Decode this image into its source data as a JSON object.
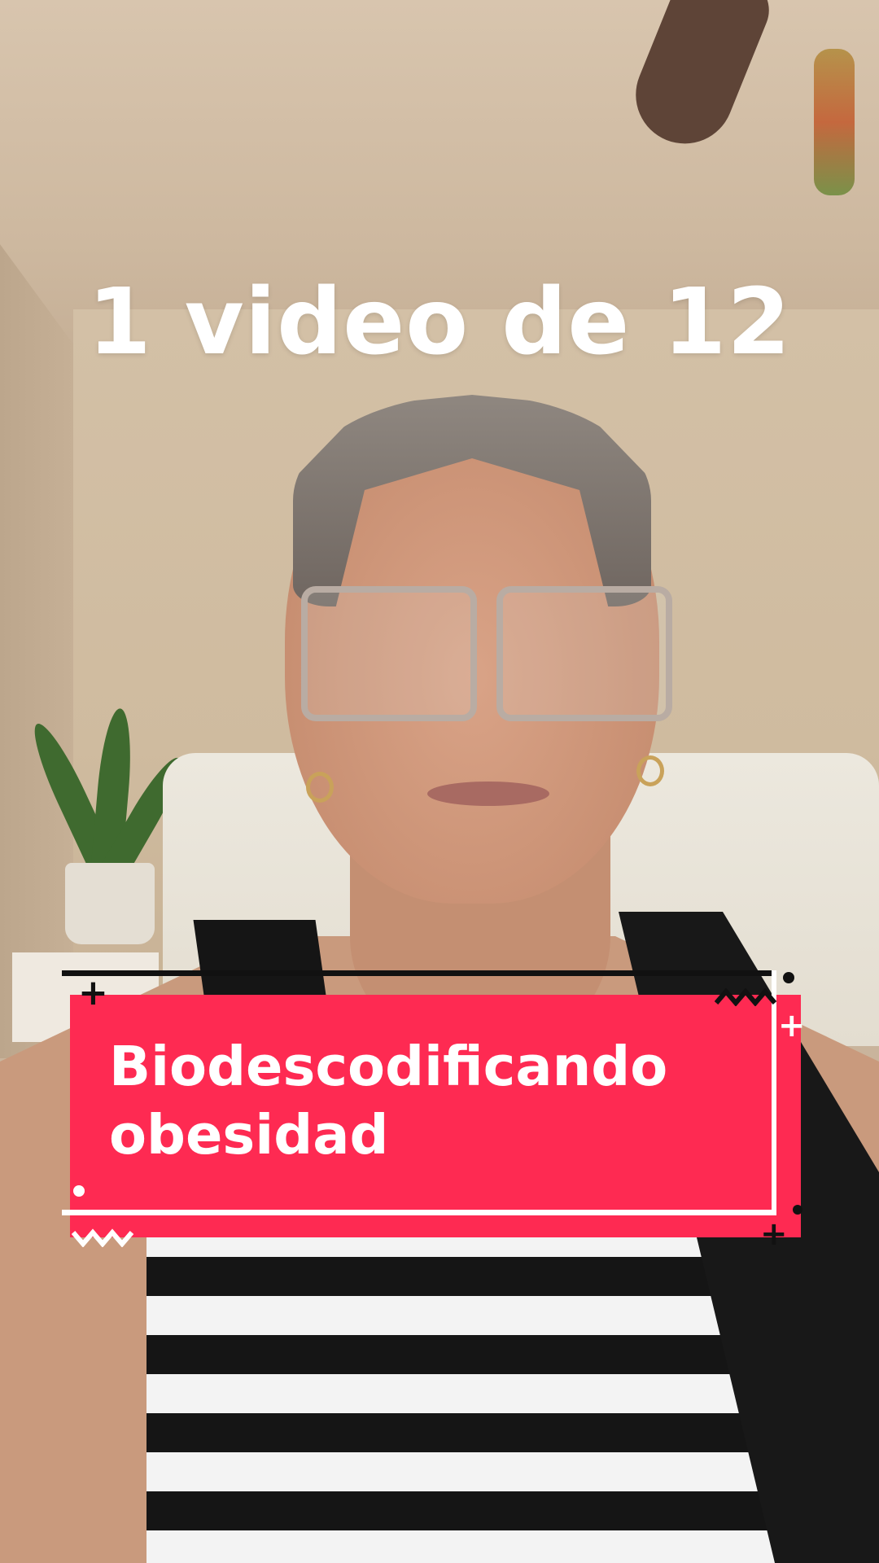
{
  "overlay": {
    "top_caption": "1 video de 12",
    "banner_line1": "Biodescodificando",
    "banner_line2": "obesidad"
  },
  "colors": {
    "banner_background": "#fe2a52",
    "banner_text": "#ffffff",
    "caption_text": "#ffffff"
  },
  "icons": {
    "plus": "+",
    "zigzag": "zigzag-line"
  }
}
